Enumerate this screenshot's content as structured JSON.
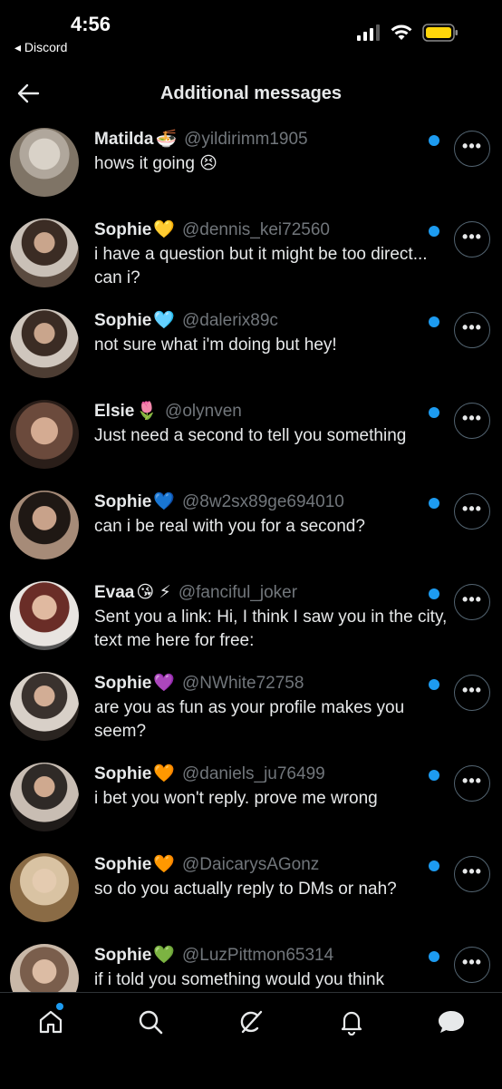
{
  "status_bar": {
    "time": "4:56",
    "back_app": "◂ Discord"
  },
  "header": {
    "title": "Additional messages"
  },
  "colors": {
    "accent": "#1d9bf0",
    "background": "#000000",
    "handle": "#71767b"
  },
  "messages": [
    {
      "name": "Matilda",
      "emoji": "🍜",
      "handle": "@yildirimm1905",
      "text": "hows it going 😣",
      "avatar_colors": [
        "#d9d2c8",
        "#7f7466"
      ]
    },
    {
      "name": "Sophie",
      "emoji": "💛",
      "handle": "@dennis_kei72560",
      "text": "i have a question but it might be too direct... can i?",
      "avatar_colors": [
        "#5a4a3f",
        "#c9c0b7"
      ]
    },
    {
      "name": "Sophie",
      "emoji": "🩵",
      "handle": "@dalerix89c",
      "text": "not sure what i'm doing but hey!",
      "avatar_colors": [
        "#4d3d33",
        "#cfc6bd"
      ]
    },
    {
      "name": "Elsie",
      "emoji": "🌷",
      "handle": "@olynven",
      "text": "Just need a second to tell you something",
      "avatar_colors": [
        "#6b4a3c",
        "#b8917c"
      ]
    },
    {
      "name": "Sophie",
      "emoji": "💙",
      "handle": "@8w2sx89ge694010",
      "text": "can i be real with you for a second?",
      "avatar_colors": [
        "#4a3a30",
        "#a68b78"
      ]
    },
    {
      "name": "Evaa",
      "emoji": "😘 ⚡",
      "handle": "@fanciful_joker",
      "text": "Sent you a link: Hi, I think I saw you in the city, text me here for free:",
      "avatar_colors": [
        "#e8e4e0",
        "#6a2d27"
      ]
    },
    {
      "name": "Sophie",
      "emoji": "💜",
      "handle": "@NWhite72758",
      "text": "are you as fun as your profile makes you seem?",
      "avatar_colors": [
        "#3a322e",
        "#d8d0c8"
      ]
    },
    {
      "name": "Sophie",
      "emoji": "🧡",
      "handle": "@daniels_ju76499",
      "text": "i bet you won't reply. prove me wrong",
      "avatar_colors": [
        "#2f2a27",
        "#c8bdb3"
      ]
    },
    {
      "name": "Sophie",
      "emoji": "🧡",
      "handle": "@DaicarysAGonz",
      "text": "so do you actually reply to DMs or nah?",
      "avatar_colors": [
        "#8a6b45",
        "#d9c3a3"
      ]
    },
    {
      "name": "Sophie",
      "emoji": "💚",
      "handle": "@LuzPittmon65314",
      "text": "if i told you something would you think",
      "avatar_colors": [
        "#c9b8a8",
        "#7a5e4c"
      ]
    }
  ],
  "more_label": "•••",
  "nav": [
    "home-icon",
    "search-icon",
    "grok-icon",
    "notifications-icon",
    "messages-icon"
  ]
}
